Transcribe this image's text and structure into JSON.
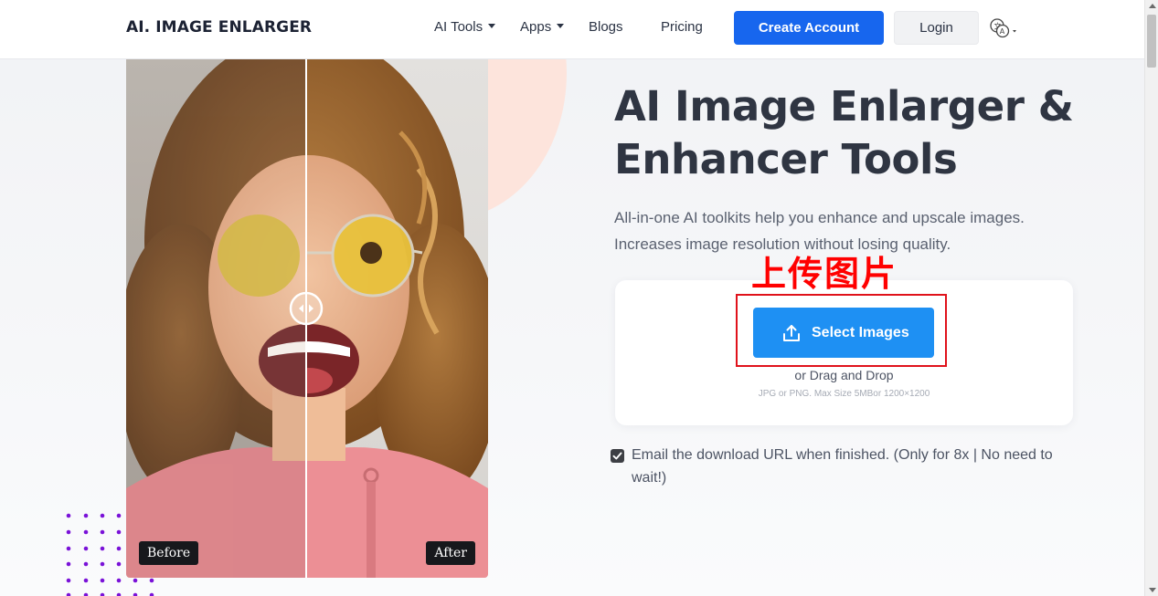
{
  "header": {
    "logo": "AI. IMAGE ENLARGER",
    "nav": {
      "ai_tools": "AI Tools",
      "apps": "Apps",
      "blogs": "Blogs",
      "pricing": "Pricing"
    },
    "create_account": "Create Account",
    "login": "Login",
    "language_icon": "language-icon"
  },
  "compare": {
    "before_label": "Before",
    "after_label": "After"
  },
  "hero": {
    "title_line1": "AI Image Enlarger &",
    "title_line2": "Enhancer Tools",
    "subtitle_line1": "All-in-one AI toolkits help you enhance and upscale images.",
    "subtitle_line2": "Increases image resolution without losing quality."
  },
  "annotation": {
    "text": "上传图片",
    "color": "#ff0000"
  },
  "upload": {
    "button_label": "Select Images",
    "drag_text": "or Drag and Drop",
    "hint": "JPG or PNG. Max Size 5MBor 1200×1200"
  },
  "email_option": {
    "checked": true,
    "text": "Email the download URL when finished. (Only for 8x | No need to wait!)"
  },
  "colors": {
    "primary": "#1766ee",
    "select_button": "#1e90f3",
    "annotation_border": "#e0121b",
    "peach": "#fde4dc",
    "dots": "#7a12d8"
  }
}
